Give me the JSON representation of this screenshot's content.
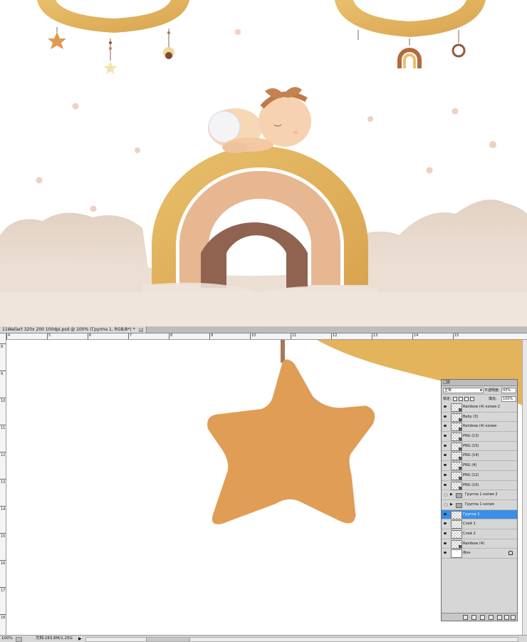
{
  "document_tab": {
    "title": "11Wallart 320x 200 100dpi.psd @ 100% (Группа 1, RGB/8*) *",
    "close_glyph": "×"
  },
  "ruler": {
    "horizontal_labels": [
      "4",
      "5",
      "6",
      "7",
      "8",
      "9",
      "10",
      "11",
      "12",
      "13",
      "14",
      "15"
    ],
    "vertical_labels": [
      "8",
      "9",
      "10",
      "11",
      "12",
      "13",
      "14",
      "15",
      "16",
      "17",
      "18"
    ]
  },
  "status_bar": {
    "zoom": "100%",
    "document_info": "文档:283.8M/1.25G",
    "arrow": "▶"
  },
  "layers_panel": {
    "title": "图层",
    "close_glyph": "×",
    "blend_mode": "正常",
    "opacity_label": "不透明度:",
    "opacity_value": "43%",
    "lock_label": "锁定:",
    "fill_label": "填充:",
    "fill_value": "100%",
    "layers": [
      {
        "name": "Rainbow (4) копия 2",
        "kind": "smart",
        "visible": true,
        "selected": false
      },
      {
        "name": "Baby (3)",
        "kind": "smart",
        "visible": true,
        "selected": false
      },
      {
        "name": "Rainbow (4) копия",
        "kind": "smart",
        "visible": true,
        "selected": false
      },
      {
        "name": "PNG (13)",
        "kind": "smart",
        "visible": true,
        "selected": false
      },
      {
        "name": "PNG (15)",
        "kind": "smart",
        "visible": true,
        "selected": false
      },
      {
        "name": "PNG (14)",
        "kind": "smart",
        "visible": true,
        "selected": false
      },
      {
        "name": "PNG (4)",
        "kind": "smart",
        "visible": true,
        "selected": false
      },
      {
        "name": "PNG (12)",
        "kind": "smart",
        "visible": true,
        "selected": false
      },
      {
        "name": "PNG (10)",
        "kind": "smart",
        "visible": true,
        "selected": false
      },
      {
        "name": "Группа 1 копия 2",
        "kind": "group",
        "visible": false,
        "selected": false
      },
      {
        "name": "Группа 1 копия",
        "kind": "group",
        "visible": false,
        "selected": false
      },
      {
        "name": "Группа 1",
        "kind": "raster",
        "visible": true,
        "selected": true
      },
      {
        "name": "Слой 1",
        "kind": "raster",
        "visible": true,
        "selected": false
      },
      {
        "name": "Слой 2",
        "kind": "raster",
        "visible": true,
        "selected": false
      },
      {
        "name": "Rainbow (4)",
        "kind": "smart",
        "visible": true,
        "selected": false
      },
      {
        "name": "Фон",
        "kind": "background",
        "visible": true,
        "selected": false
      }
    ]
  },
  "colors": {
    "selected_layer": "#3a8ee6",
    "rainbow_outer": "#e3b45c",
    "rainbow_middle": "#e6b791",
    "rainbow_inner": "#8f6350",
    "star": "#e09d55",
    "cloud": "#ede2d8"
  },
  "icons": [
    "eye-icon",
    "folder-icon",
    "smart-object-icon",
    "lock-icon",
    "close-icon",
    "dropdown-icon"
  ]
}
